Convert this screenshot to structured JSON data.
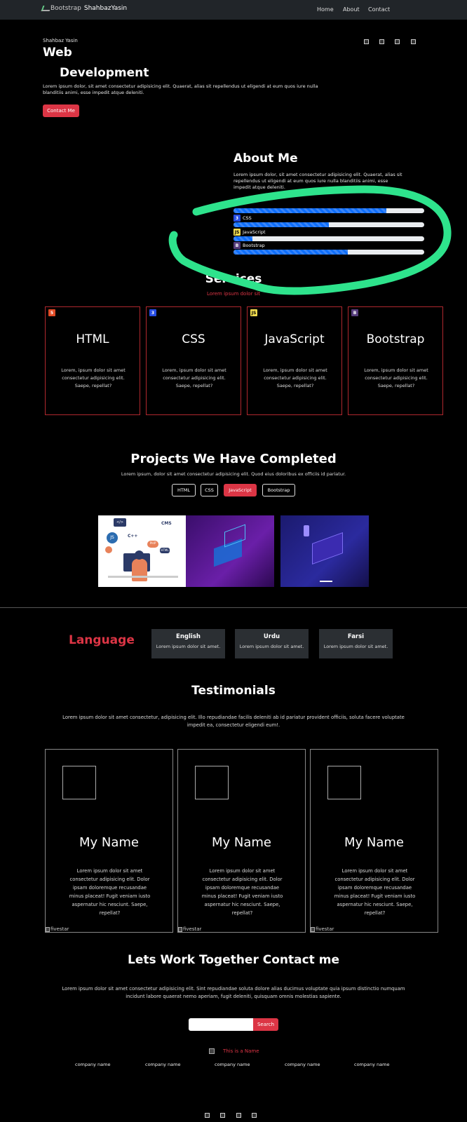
{
  "nav": {
    "brand_alt": "Bootstrap",
    "brand_name": "ShahbazYasin",
    "links": [
      "Home",
      "About",
      "Contact"
    ]
  },
  "hero": {
    "subtitle": "Shahbaz Yasin",
    "title_line1": "Web",
    "title_line2": "Development",
    "text": "Lorem ipsum dolor, sit amet consectetur adipisicing elit. Quaerat, alias sit repellendus ut eligendi at eum quos iure nulla blanditiis animi, esse impedit atque deleniti.",
    "button": "Contact Me"
  },
  "about": {
    "title": "About Me",
    "text": "Lorem ipsum dolor, sit amet consectetur adipisicing elit. Quaerat, alias sit repellendus ut eligendi at eum quos iure nulla blanditiis animi, esse impedit atque deleniti.",
    "skills": [
      {
        "label": "",
        "badge": "",
        "level": 0.8
      },
      {
        "label": "CSS",
        "badge": "3",
        "level": 0.5
      },
      {
        "label": "JavaScript",
        "badge": "JS",
        "level": 0.1
      },
      {
        "label": "Bootstrap",
        "badge": "B",
        "level": 0.6
      }
    ],
    "colors": {
      "track": "#e9ecef",
      "fill": "#0d6efd"
    }
  },
  "services": {
    "title": "Services",
    "subtitle": "Lorem ipsum dolor sit",
    "cards": [
      {
        "title": "HTML",
        "badge": "5",
        "text": "Lorem, ipsum dolor sit amet consectetur adipisicing elit. Saepe, repellat?"
      },
      {
        "title": "CSS",
        "badge": "3",
        "text": "Lorem, ipsum dolor sit amet consectetur adipisicing elit. Saepe, repellat?"
      },
      {
        "title": "JavaScript",
        "badge": "JS",
        "text": "Lorem, ipsum dolor sit amet consectetur adipisicing elit. Saepe, repellat?"
      },
      {
        "title": "Bootstrap",
        "badge": "B",
        "text": "Lorem, ipsum dolor sit amet consectetur adipisicing elit. Saepe, repellat?"
      }
    ]
  },
  "projects": {
    "title": "Projects We Have Completed",
    "text": "Lorem ipsum, dolor sit amet consectetur adipisicing elit. Quod eius doloribus ex officiis id pariatur.",
    "filters": [
      "HTML",
      "CSS",
      "JavaScript",
      "Bootstrap"
    ],
    "active_filter": "JavaScript",
    "image_labels": [
      "</>",
      "CMS",
      "C++",
      "JS",
      "PHP",
      "HTML"
    ]
  },
  "language": {
    "title": "Language",
    "items": [
      {
        "name": "English",
        "text": "Lorem ipsum dolor sit amet."
      },
      {
        "name": "Urdu",
        "text": "Lorem ipsum dolor sit amet."
      },
      {
        "name": "Farsi",
        "text": "Lorem ipsum dolor sit amet."
      }
    ]
  },
  "testimonials": {
    "title": "Testimonials",
    "text": "Lorem ipsum dolor sit amet consectetur, adipisicing elit. Illo repudiandae facilis deleniti ab id pariatur provident officiis, soluta facere voluptate impedit ea, consectetur eligendi eum!.",
    "cards": [
      {
        "name": "My Name",
        "text": "Lorem ipsum dolor sit amet consectetur adipisicing elit. Dolor ipsam doloremque recusandae minus placeat! Fugit veniam iusto aspernatur hic nesciunt. Saepe, repellat?",
        "img_alt": "fivestar"
      },
      {
        "name": "My Name",
        "text": "Lorem ipsum dolor sit amet consectetur adipisicing elit. Dolor ipsam doloremque recusandae minus placeat! Fugit veniam iusto aspernatur hic nesciunt. Saepe, repellat?",
        "img_alt": "fivestar"
      },
      {
        "name": "My Name",
        "text": "Lorem ipsum dolor sit amet consectetur adipisicing elit. Dolor ipsam doloremque recusandae minus placeat! Fugit veniam iusto aspernatur hic nesciunt. Saepe, repellat?",
        "img_alt": "fivestar"
      }
    ]
  },
  "contact": {
    "title": "Lets Work Together Contact me",
    "text": "Lorem ipsum dolor sit amet consectetur adipisicing elit. Sint repudiandae soluta dolore alias ducimus voluptate quia ipsum distinctio numquam incidunt labore quaerat nemo aperiam, fugit deleniti, quisquam omnis molestias sapiente.",
    "input_value": "",
    "button": "Search"
  },
  "footer": {
    "name": "This is a Name",
    "companies": [
      "company name",
      "company name",
      "company name",
      "company name",
      "company name"
    ]
  },
  "colors": {
    "accent": "#dc3545",
    "highlight": "#2ee38c",
    "nav": "#212529"
  }
}
